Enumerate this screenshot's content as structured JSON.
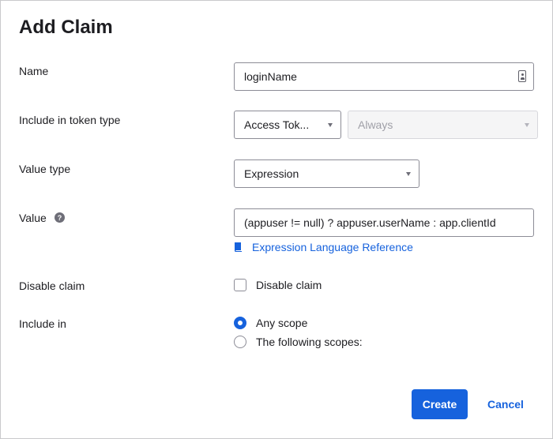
{
  "dialog": {
    "title": "Add Claim"
  },
  "name": {
    "label": "Name",
    "value": "loginName"
  },
  "token_type": {
    "label": "Include in token type",
    "selected": "Access Tok...",
    "frequency": "Always"
  },
  "value_type": {
    "label": "Value type",
    "selected": "Expression"
  },
  "value": {
    "label": "Value",
    "help": "?",
    "expression": "(appuser != null) ? appuser.userName : app.clientId",
    "link_label": "Expression Language Reference"
  },
  "disable_claim": {
    "label": "Disable claim",
    "checkbox_label": "Disable claim",
    "checked": false
  },
  "include_in": {
    "label": "Include in",
    "options": [
      {
        "label": "Any scope",
        "checked": true
      },
      {
        "label": "The following scopes:",
        "checked": false
      }
    ]
  },
  "actions": {
    "create_label": "Create",
    "cancel_label": "Cancel"
  },
  "colors": {
    "accent": "#1662dd",
    "text": "#1d1d21",
    "border": "#8c8c96"
  },
  "icons": {
    "name_field": "contact-card-icon",
    "value_help": "help-circle-icon",
    "link": "book-icon"
  }
}
